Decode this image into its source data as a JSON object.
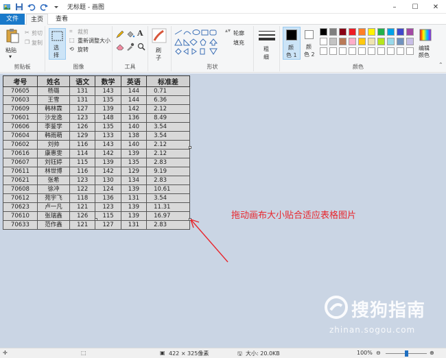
{
  "titlebar": {
    "title": "无标题 - 画图",
    "controls": [
      "–",
      "☐",
      "✕"
    ]
  },
  "tabs": {
    "file": "文件",
    "home": "主页",
    "view": "查看"
  },
  "ribbon": {
    "clipboard": {
      "paste": "粘贴",
      "cut": "剪切",
      "copy": "复制",
      "label": "剪贴板"
    },
    "image": {
      "select": "选",
      "select2": "择",
      "crop": "裁剪",
      "resize": "重新调整大小",
      "rotate": "旋转",
      "label": "图像"
    },
    "tools": {
      "label": "工具",
      "text_tool": "A"
    },
    "brushes": {
      "label": "刷",
      "label2": "子"
    },
    "shapes": {
      "outline": "轮廓",
      "fill": "填充",
      "label": "形状"
    },
    "size": {
      "label": "粗",
      "label2": "细"
    },
    "colors": {
      "color1": "颜",
      "color1b": "色 1",
      "color2": "颜",
      "color2b": "色 2",
      "edit": "编辑",
      "edit2": "颜色",
      "label": "颜色",
      "color1_value": "#000000",
      "color2_value": "#ffffff",
      "palette_row1": [
        "#000000",
        "#7f7f7f",
        "#880015",
        "#ed1c24",
        "#ff7f27",
        "#fff200",
        "#22b14c",
        "#00a2e8",
        "#3f48cc",
        "#a349a4"
      ],
      "palette_row2": [
        "#ffffff",
        "#c3c3c3",
        "#b97a57",
        "#ffaec9",
        "#ffc90e",
        "#efe4b0",
        "#b5e61d",
        "#99d9ea",
        "#7092be",
        "#c8bfe7"
      ]
    }
  },
  "table": {
    "headers": [
      "考号",
      "姓名",
      "语文",
      "数学",
      "英语",
      "标准差"
    ],
    "rows": [
      [
        "70605",
        "杨璐",
        "131",
        "143",
        "144",
        "0.71"
      ],
      [
        "70603",
        "王雪",
        "131",
        "135",
        "144",
        "6.36"
      ],
      [
        "70609",
        "韩林霖",
        "127",
        "139",
        "142",
        "2.12"
      ],
      [
        "70601",
        "沙龙逸",
        "123",
        "148",
        "136",
        "8.49"
      ],
      [
        "70606",
        "李鉴学",
        "126",
        "135",
        "140",
        "3.54"
      ],
      [
        "70604",
        "韩雨萌",
        "129",
        "133",
        "138",
        "3.54"
      ],
      [
        "70602",
        "刘帅",
        "116",
        "143",
        "140",
        "2.12"
      ],
      [
        "70616",
        "康惠雯",
        "114",
        "142",
        "139",
        "2.12"
      ],
      [
        "70607",
        "刘钰婷",
        "115",
        "139",
        "135",
        "2.83"
      ],
      [
        "70611",
        "林世博",
        "116",
        "142",
        "129",
        "9.19"
      ],
      [
        "70621",
        "张希",
        "123",
        "130",
        "134",
        "2.83"
      ],
      [
        "70608",
        "徐冲",
        "122",
        "124",
        "139",
        "10.61"
      ],
      [
        "70612",
        "苑宇飞",
        "118",
        "136",
        "131",
        "3.54"
      ],
      [
        "70623",
        "卢一凡",
        "121",
        "123",
        "139",
        "11.31"
      ],
      [
        "70610",
        "张瑞鑫",
        "126",
        "115",
        "139",
        "16.97"
      ],
      [
        "70633",
        "范作鑫",
        "121",
        "127",
        "131",
        "2.83"
      ]
    ]
  },
  "annotation": "拖动画布大小贴合适应表格图片",
  "watermark": {
    "main": "搜狗指南",
    "url": "zhinan.sogou.com"
  },
  "status": {
    "dimensions": "422 × 325像素",
    "filesize": "大小: 20.0KB",
    "zoom": "100%",
    "zoom_level": 0.5
  }
}
